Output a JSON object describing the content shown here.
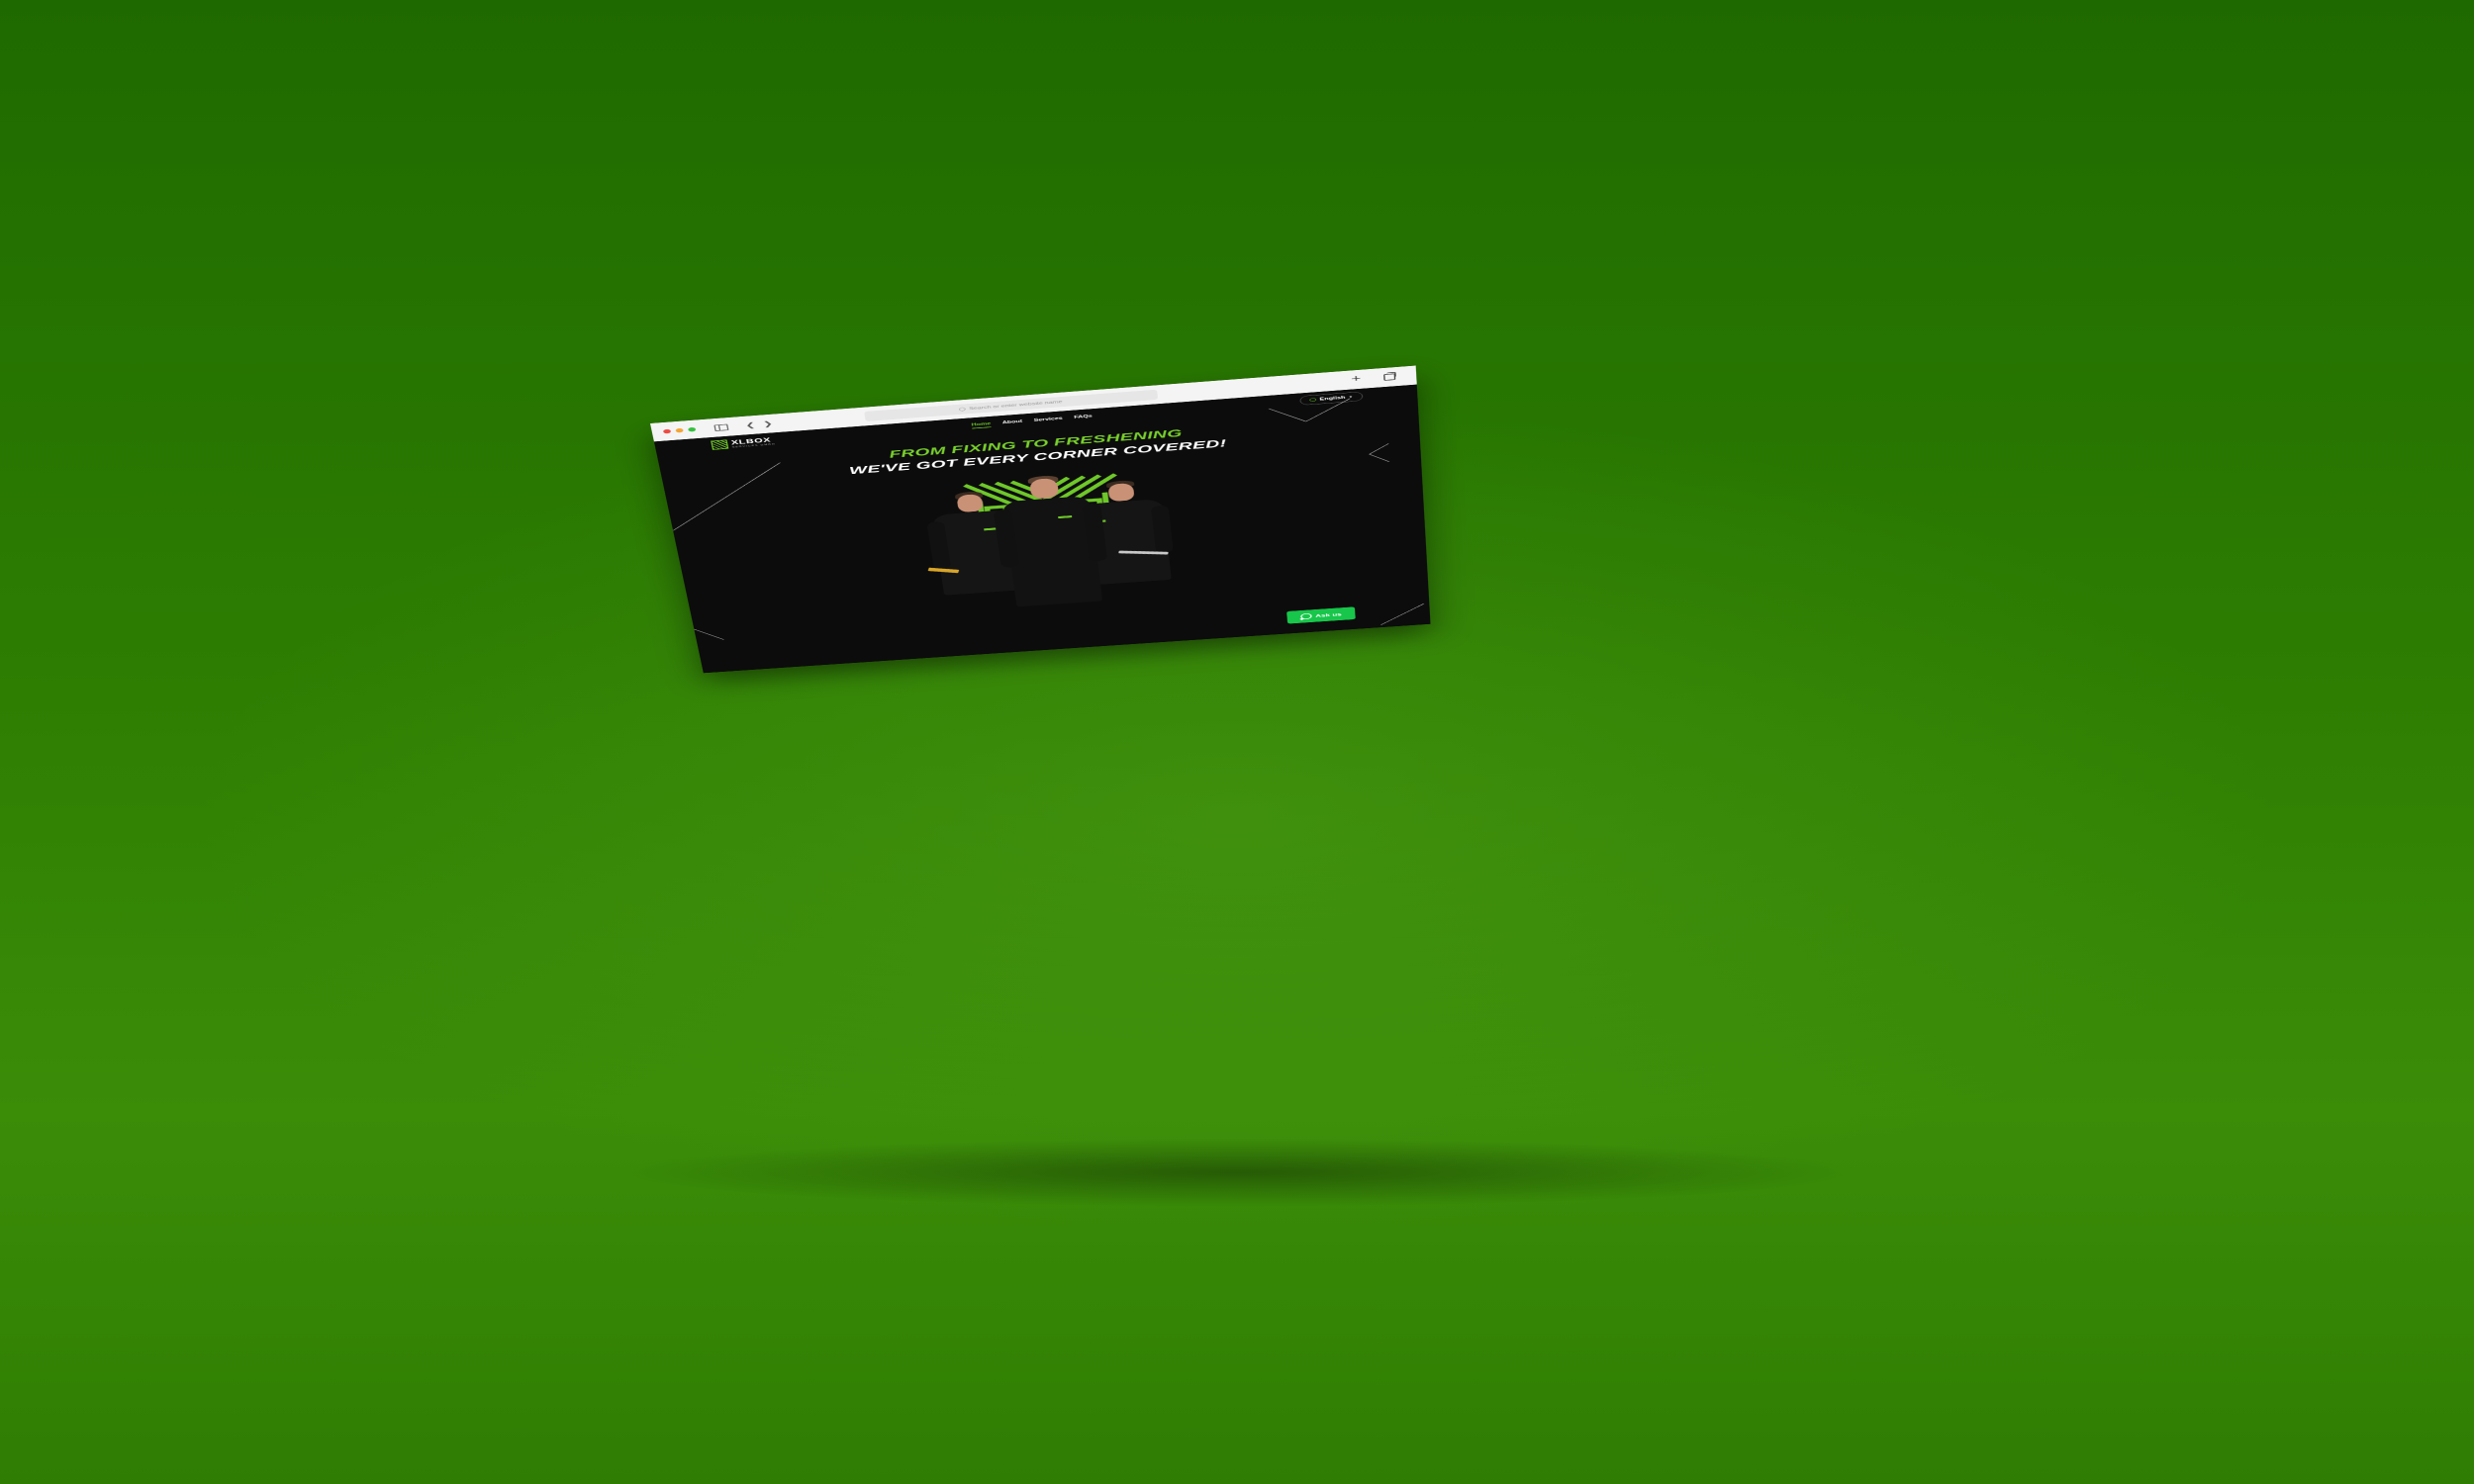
{
  "browser": {
    "url_placeholder": "Search or enter website name",
    "icons": [
      "sidebar-icon",
      "back-icon",
      "forward-icon",
      "search-icon",
      "new-tab-icon",
      "tabs-overview-icon"
    ]
  },
  "site": {
    "logo": {
      "name": "XLBOX",
      "subtitle": "SERVICES GMBH"
    },
    "nav": [
      {
        "label": "Home",
        "active": true
      },
      {
        "label": "About",
        "active": false
      },
      {
        "label": "Services",
        "active": false
      },
      {
        "label": "FAQs",
        "active": false
      }
    ],
    "language": "English",
    "headline_line1": "FROM FIXING TO FRESHENING",
    "headline_line2": "WE'VE GOT EVERY CORNER COVERED!",
    "cta": "Ask us"
  },
  "colors": {
    "accent": "#6fc82a",
    "background": "#0c0c0c",
    "whatsapp": "#17c64a",
    "scene": "#2d7d02"
  }
}
